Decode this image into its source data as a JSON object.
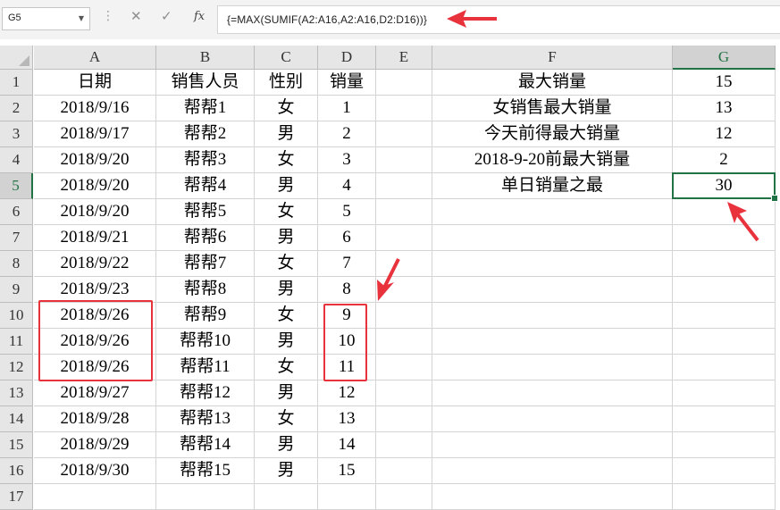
{
  "formula_bar": {
    "name_box": "G5",
    "cancel_icon": "✕",
    "enter_icon": "✓",
    "function_icon": "fx",
    "formula": "{=MAX(SUMIF(A2:A16,A2:A16,D2:D16))}"
  },
  "columns": [
    "A",
    "B",
    "C",
    "D",
    "E",
    "F",
    "G"
  ],
  "rows": [
    {
      "n": "1",
      "a": "日期",
      "b": "销售人员",
      "c": "性别",
      "d": "销量",
      "f": "最大销量",
      "g": "15"
    },
    {
      "n": "2",
      "a": "2018/9/16",
      "b": "帮帮1",
      "c": "女",
      "d": "1",
      "f": "女销售最大销量",
      "g": "13"
    },
    {
      "n": "3",
      "a": "2018/9/17",
      "b": "帮帮2",
      "c": "男",
      "d": "2",
      "f": "今天前得最大销量",
      "g": "12"
    },
    {
      "n": "4",
      "a": "2018/9/20",
      "b": "帮帮3",
      "c": "女",
      "d": "3",
      "f": "2018-9-20前最大销量",
      "g": "2"
    },
    {
      "n": "5",
      "a": "2018/9/20",
      "b": "帮帮4",
      "c": "男",
      "d": "4",
      "f": "单日销量之最",
      "g": "30"
    },
    {
      "n": "6",
      "a": "2018/9/20",
      "b": "帮帮5",
      "c": "女",
      "d": "5",
      "f": "",
      "g": ""
    },
    {
      "n": "7",
      "a": "2018/9/21",
      "b": "帮帮6",
      "c": "男",
      "d": "6",
      "f": "",
      "g": ""
    },
    {
      "n": "8",
      "a": "2018/9/22",
      "b": "帮帮7",
      "c": "女",
      "d": "7",
      "f": "",
      "g": ""
    },
    {
      "n": "9",
      "a": "2018/9/23",
      "b": "帮帮8",
      "c": "男",
      "d": "8",
      "f": "",
      "g": ""
    },
    {
      "n": "10",
      "a": "2018/9/26",
      "b": "帮帮9",
      "c": "女",
      "d": "9",
      "f": "",
      "g": ""
    },
    {
      "n": "11",
      "a": "2018/9/26",
      "b": "帮帮10",
      "c": "男",
      "d": "10",
      "f": "",
      "g": ""
    },
    {
      "n": "12",
      "a": "2018/9/26",
      "b": "帮帮11",
      "c": "女",
      "d": "11",
      "f": "",
      "g": ""
    },
    {
      "n": "13",
      "a": "2018/9/27",
      "b": "帮帮12",
      "c": "男",
      "d": "12",
      "f": "",
      "g": ""
    },
    {
      "n": "14",
      "a": "2018/9/28",
      "b": "帮帮13",
      "c": "女",
      "d": "13",
      "f": "",
      "g": ""
    },
    {
      "n": "15",
      "a": "2018/9/29",
      "b": "帮帮14",
      "c": "男",
      "d": "14",
      "f": "",
      "g": ""
    },
    {
      "n": "16",
      "a": "2018/9/30",
      "b": "帮帮15",
      "c": "男",
      "d": "15",
      "f": "",
      "g": ""
    },
    {
      "n": "17",
      "a": "",
      "b": "",
      "c": "",
      "d": "",
      "f": "",
      "g": ""
    }
  ],
  "active_cell": "G5",
  "colors": {
    "accent": "#217346",
    "annotation": "#e8323c"
  }
}
